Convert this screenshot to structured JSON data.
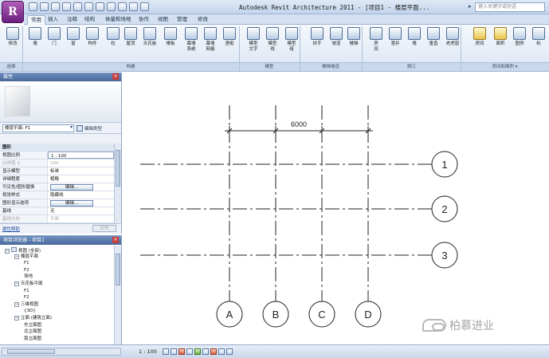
{
  "app": {
    "button_label": "R",
    "title": "Autodesk Revit Architecture 2011 - [项目1 - 楼层平面...",
    "search_placeholder": "键入关键字或短语"
  },
  "ribbon": {
    "tabs": [
      "常用",
      "插入",
      "注释",
      "结构",
      "体量和场地",
      "协作",
      "视图",
      "管理",
      "修改"
    ],
    "active_tab": "常用",
    "tools": [
      {
        "label": "修改",
        "icon": "cursor-icon",
        "highlight": false
      },
      {
        "label": "墙",
        "icon": "wall-icon",
        "highlight": false
      },
      {
        "label": "门",
        "icon": "door-icon",
        "highlight": false
      },
      {
        "label": "窗",
        "icon": "window-icon",
        "highlight": false
      },
      {
        "label": "构件",
        "icon": "component-icon",
        "highlight": false
      },
      {
        "label": "柱",
        "icon": "column-icon",
        "highlight": false
      },
      {
        "label": "屋顶",
        "icon": "roof-icon",
        "highlight": false
      },
      {
        "label": "天花板",
        "icon": "ceiling-icon",
        "highlight": false
      },
      {
        "label": "楼板",
        "icon": "floor-icon",
        "highlight": false
      },
      {
        "label": "幕墙\n系统",
        "icon": "curtain-system-icon",
        "highlight": false
      },
      {
        "label": "幕墙\n网格",
        "icon": "curtain-grid-icon",
        "highlight": false
      },
      {
        "label": "竖梃",
        "icon": "mullion-icon",
        "highlight": false
      },
      {
        "label": "模型\n文字",
        "icon": "model-text-icon",
        "highlight": false
      },
      {
        "label": "模型\n线",
        "icon": "model-line-icon",
        "highlight": false
      },
      {
        "label": "模型\n组",
        "icon": "model-group-icon",
        "highlight": false
      },
      {
        "label": "扶手",
        "icon": "railing-icon",
        "highlight": false
      },
      {
        "label": "坡道",
        "icon": "ramp-icon",
        "highlight": false
      },
      {
        "label": "楼梯",
        "icon": "stair-icon",
        "highlight": false
      },
      {
        "label": "房\n间",
        "icon": "room-icon",
        "highlight": false
      },
      {
        "label": "竖井",
        "icon": "shaft-icon",
        "highlight": false
      },
      {
        "label": "墙",
        "icon": "wall-opening-icon",
        "highlight": false
      },
      {
        "label": "垂直",
        "icon": "vertical-opening-icon",
        "highlight": false
      },
      {
        "label": "老虎窗",
        "icon": "dormer-icon",
        "highlight": false
      },
      {
        "label": "房间",
        "icon": "room-area-icon",
        "highlight": true
      },
      {
        "label": "面积",
        "icon": "area-icon",
        "highlight": true
      },
      {
        "label": "图例",
        "icon": "legend-icon",
        "highlight": false
      },
      {
        "label": "标",
        "icon": "tag-icon",
        "highlight": false
      }
    ],
    "groups": [
      "选择",
      "构建",
      "模型",
      "楼梯坡道",
      "洞口",
      "房间和面积 ▾"
    ]
  },
  "properties": {
    "title": "属性",
    "type_selector": "楼层平面: F1",
    "edit_type": "编辑类型",
    "section": "图形",
    "rows": [
      {
        "key": "视图比例",
        "value": "1 : 100",
        "kind": "input"
      },
      {
        "key": "比例值 1:",
        "value": "100",
        "kind": "dim"
      },
      {
        "key": "显示模型",
        "value": "标准",
        "kind": "text"
      },
      {
        "key": "详细程度",
        "value": "粗略",
        "kind": "text"
      },
      {
        "key": "可见性/图形替换",
        "value": "编辑...",
        "kind": "button"
      },
      {
        "key": "视觉样式",
        "value": "隐藏线",
        "kind": "text"
      },
      {
        "key": "图形显示选项",
        "value": "编辑...",
        "kind": "button"
      },
      {
        "key": "基线",
        "value": "无",
        "kind": "text"
      },
      {
        "key": "基线方向",
        "value": "平面",
        "kind": "dim"
      }
    ],
    "help": "属性帮助",
    "apply": "应用"
  },
  "browser": {
    "title": "项目浏览器 - 项目1",
    "nodes": [
      {
        "label": "视图 (全部)",
        "level": 0,
        "exp": "−",
        "icon": true
      },
      {
        "label": "楼层平面",
        "level": 1,
        "exp": "−",
        "icon": false
      },
      {
        "label": "F1",
        "level": 2,
        "exp": "",
        "icon": false
      },
      {
        "label": "F2",
        "level": 2,
        "exp": "",
        "icon": false
      },
      {
        "label": "场地",
        "level": 2,
        "exp": "",
        "icon": false
      },
      {
        "label": "天花板平面",
        "level": 1,
        "exp": "−",
        "icon": false
      },
      {
        "label": "F1",
        "level": 2,
        "exp": "",
        "icon": false
      },
      {
        "label": "F2",
        "level": 2,
        "exp": "",
        "icon": false
      },
      {
        "label": "三维视图",
        "level": 1,
        "exp": "−",
        "icon": false
      },
      {
        "label": "{3D}",
        "level": 2,
        "exp": "",
        "icon": false
      },
      {
        "label": "立面 (建筑立面)",
        "level": 1,
        "exp": "−",
        "icon": false
      },
      {
        "label": "东立面图",
        "level": 2,
        "exp": "",
        "icon": false
      },
      {
        "label": "北立面图",
        "level": 2,
        "exp": "",
        "icon": false
      },
      {
        "label": "南立面图",
        "level": 2,
        "exp": "",
        "icon": false
      }
    ]
  },
  "statusbar": {
    "scale": "1 : 100"
  },
  "drawing": {
    "dimension": "6000",
    "horizontal_grids": [
      "1",
      "2",
      "3"
    ],
    "vertical_grids": [
      "A",
      "B",
      "C",
      "D"
    ]
  },
  "watermark": {
    "text": "柏慕进业"
  }
}
